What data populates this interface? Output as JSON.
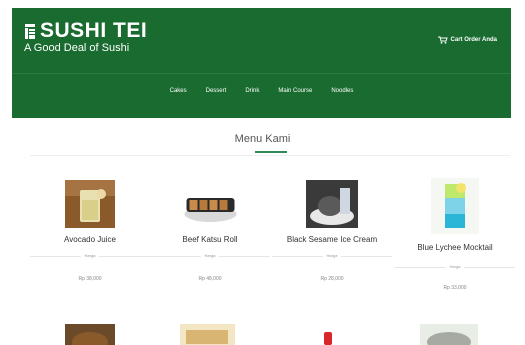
{
  "brand": {
    "name": "SUSHI TEI",
    "tagline": "A Good  Deal of Sushi"
  },
  "header": {
    "cart_label": "Cart Order Anda"
  },
  "nav": [
    "Cakes",
    "Dessert",
    "Drink",
    "Main Course",
    "Noodles"
  ],
  "section": {
    "title": "Menu Kami"
  },
  "products": [
    {
      "name": "Avocado Juice",
      "label": "Harga",
      "price": "Rp 38,000"
    },
    {
      "name": "Beef Katsu Roll",
      "label": "Harga",
      "price": "Rp 48,000"
    },
    {
      "name": "Black Sesame Ice Cream",
      "label": "Harga",
      "price": "Rp 28,000"
    },
    {
      "name": "Blue Lychee Mocktail",
      "label": "Harga",
      "price": "Rp 33,000"
    }
  ],
  "colors": {
    "header": "#1a6b30",
    "accent": "#2e8b57"
  }
}
